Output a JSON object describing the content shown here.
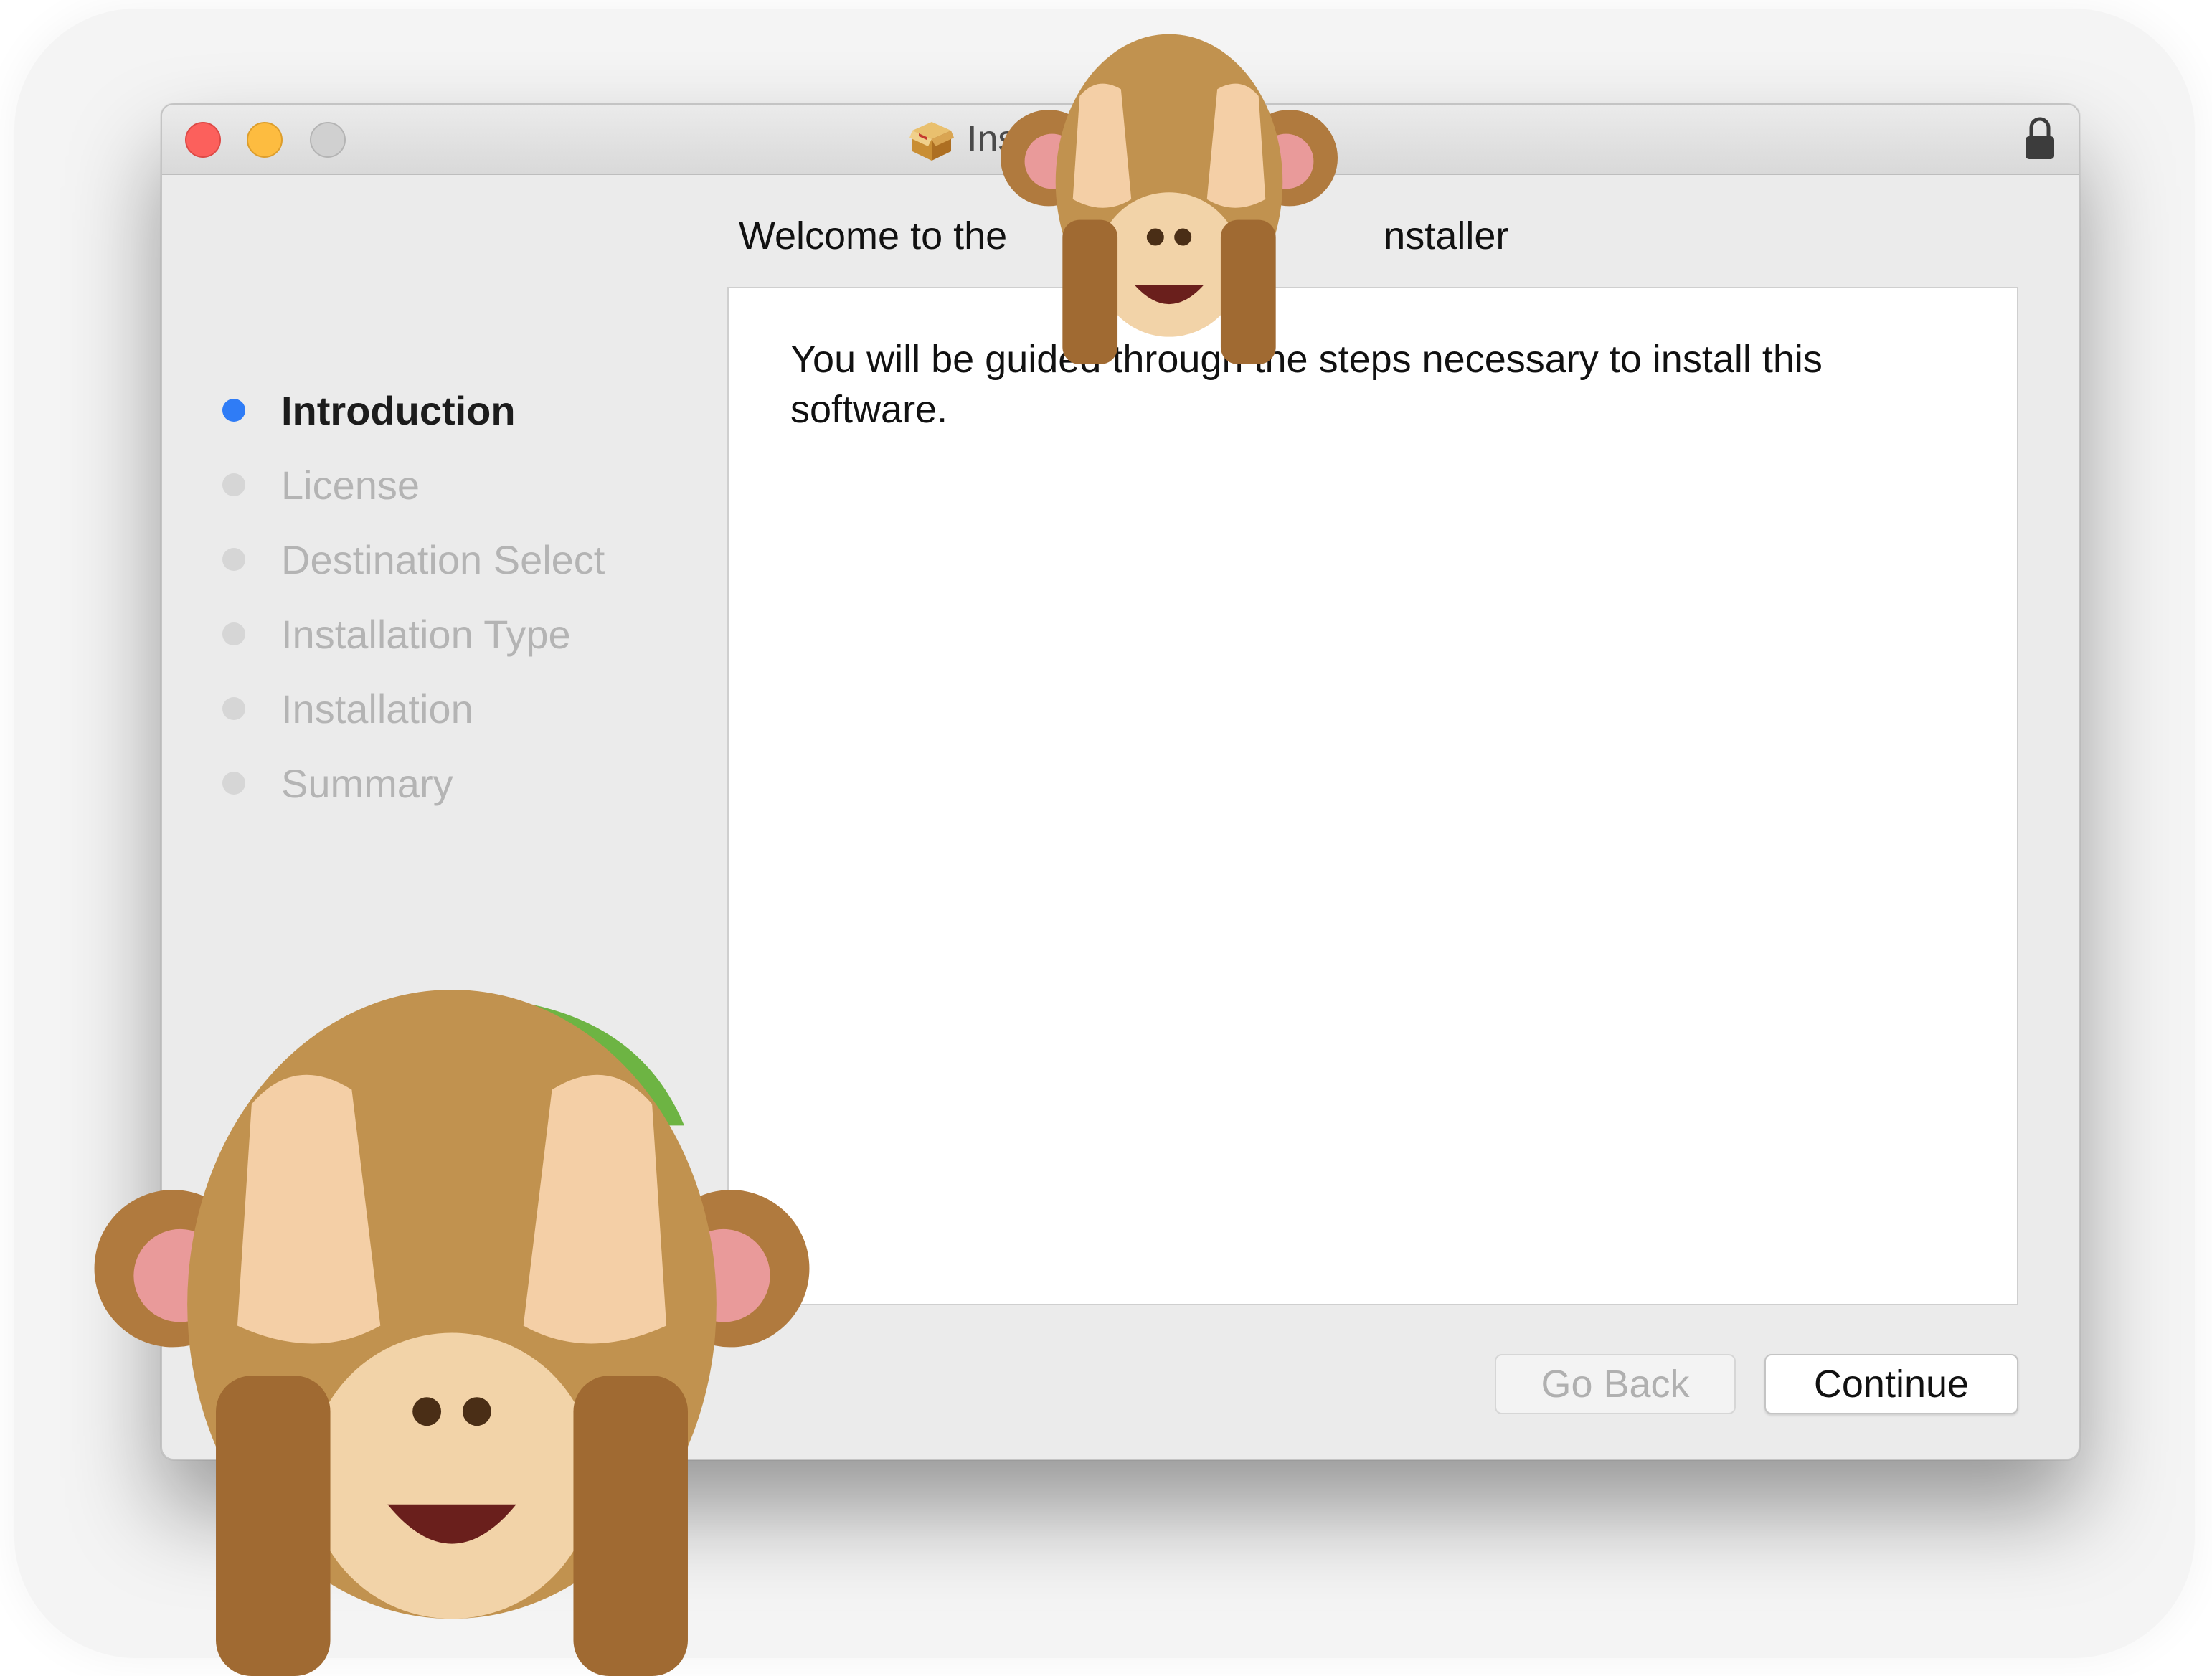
{
  "window": {
    "title": "Ins",
    "heading": "Welcome to the                                   nstaller"
  },
  "sidebar": {
    "steps": [
      {
        "label": "Introduction",
        "active": true
      },
      {
        "label": "License",
        "active": false
      },
      {
        "label": "Destination Select",
        "active": false
      },
      {
        "label": "Installation Type",
        "active": false
      },
      {
        "label": "Installation",
        "active": false
      },
      {
        "label": "Summary",
        "active": false
      }
    ]
  },
  "content": {
    "body": "You will be guided through the steps necessary to install this software."
  },
  "buttons": {
    "go_back": "Go Back",
    "continue": "Continue"
  },
  "colors": {
    "accent": "#2f7cf6",
    "close": "#fc605c",
    "minimize": "#fdbc40",
    "zoom_disabled": "#d0d0d0"
  },
  "icons": [
    "package-icon",
    "lock-icon",
    "see-no-evil-monkey-icon"
  ]
}
